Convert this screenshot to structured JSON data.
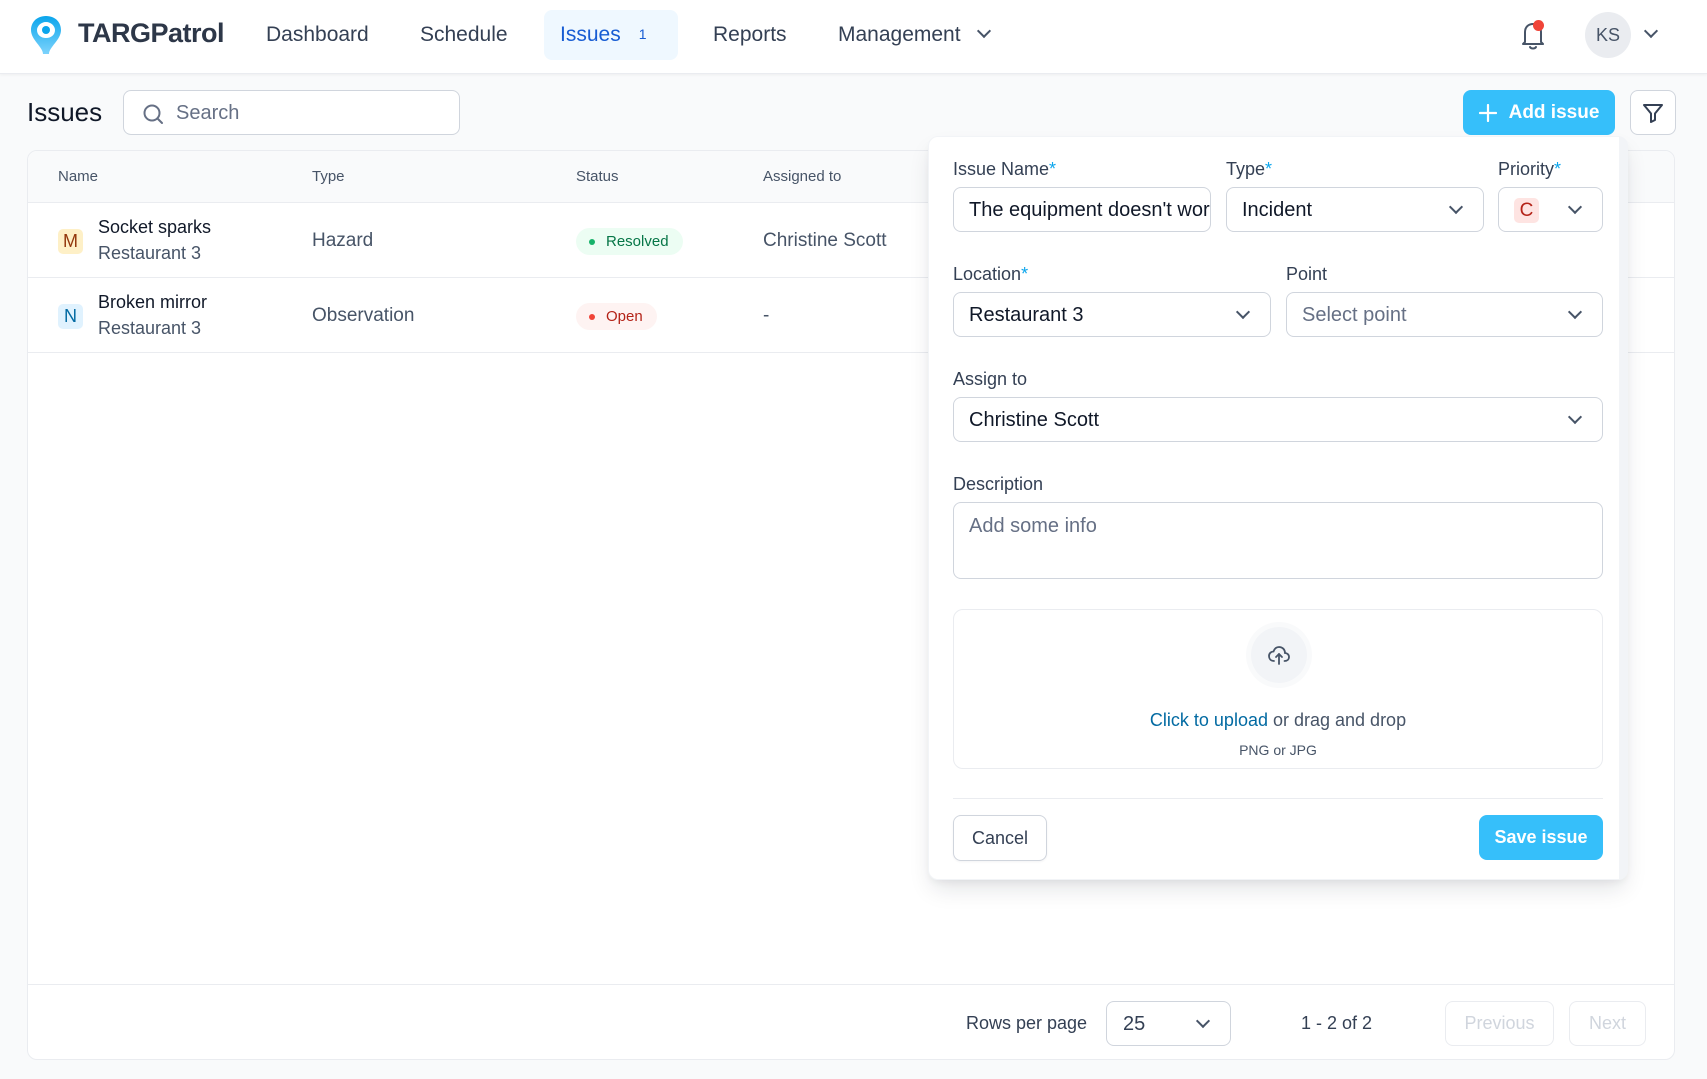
{
  "app": {
    "name": "TARGPatrol",
    "brand_color": "#36bffa"
  },
  "nav": {
    "items": [
      {
        "label": "Dashboard"
      },
      {
        "label": "Schedule"
      },
      {
        "label": "Issues",
        "badge": "1",
        "active": true
      },
      {
        "label": "Reports"
      },
      {
        "label": "Management",
        "has_dropdown": true
      }
    ],
    "notifications_icon": "bell-icon",
    "has_unread_notifications": true,
    "user_initials": "KS"
  },
  "page": {
    "title": "Issues",
    "search_placeholder": "Search",
    "add_button_label": "Add issue",
    "filter_icon": "filter-icon"
  },
  "table": {
    "columns": [
      "Name",
      "Type",
      "Status",
      "Assigned to"
    ],
    "rows": [
      {
        "priority": "M",
        "name": "Socket sparks",
        "location": "Restaurant 3",
        "type": "Hazard",
        "status": "Resolved",
        "assigned_to": "Christine Scott"
      },
      {
        "priority": "N",
        "name": "Broken mirror",
        "location": "Restaurant 3",
        "type": "Observation",
        "status": "Open",
        "assigned_to": "-"
      }
    ],
    "footer": {
      "rows_per_page_label": "Rows per page",
      "rows_per_page_value": "25",
      "range_text": "1 - 2 of 2",
      "previous_label": "Previous",
      "next_label": "Next"
    }
  },
  "form": {
    "issue_name_label": "Issue Name",
    "issue_name_value": "The equipment doesn't work",
    "type_label": "Type",
    "type_value": "Incident",
    "priority_label": "Priority",
    "priority_value": "C",
    "location_label": "Location",
    "location_value": "Restaurant 3",
    "point_label": "Point",
    "point_placeholder": "Select point",
    "assign_label": "Assign to",
    "assign_value": "Christine Scott",
    "description_label": "Description",
    "description_placeholder": "Add some info",
    "upload_link": "Click to upload",
    "upload_text": " or drag and drop",
    "upload_hint": "PNG or JPG",
    "required_mark": "*",
    "cancel_label": "Cancel",
    "save_label": "Save issue"
  }
}
